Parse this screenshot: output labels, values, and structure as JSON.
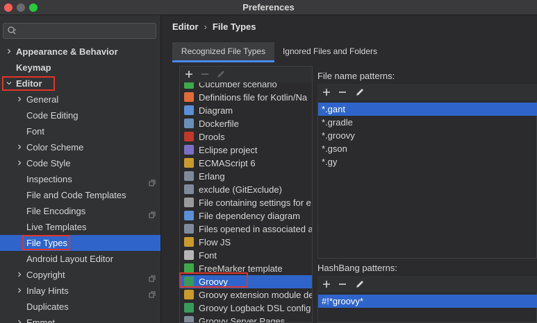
{
  "window": {
    "title": "Preferences"
  },
  "search": {
    "placeholder": ""
  },
  "sidebar": {
    "items": [
      {
        "label": "Appearance & Behavior",
        "bold": true,
        "chevron": "right"
      },
      {
        "label": "Keymap",
        "bold": true,
        "chevron": "none"
      },
      {
        "label": "Editor",
        "bold": true,
        "chevron": "down"
      },
      {
        "label": "General",
        "chevron": "right"
      },
      {
        "label": "Code Editing",
        "chevron": "none"
      },
      {
        "label": "Font",
        "chevron": "none"
      },
      {
        "label": "Color Scheme",
        "chevron": "right"
      },
      {
        "label": "Code Style",
        "chevron": "right"
      },
      {
        "label": "Inspections",
        "chevron": "none",
        "copy": true
      },
      {
        "label": "File and Code Templates",
        "chevron": "none"
      },
      {
        "label": "File Encodings",
        "chevron": "none",
        "copy": true
      },
      {
        "label": "Live Templates",
        "chevron": "none"
      },
      {
        "label": "File Types",
        "chevron": "none",
        "selected": true
      },
      {
        "label": "Android Layout Editor",
        "chevron": "none"
      },
      {
        "label": "Copyright",
        "chevron": "right",
        "copy": true
      },
      {
        "label": "Inlay Hints",
        "chevron": "right",
        "copy": true
      },
      {
        "label": "Duplicates",
        "chevron": "none"
      },
      {
        "label": "Emmet",
        "chevron": "right"
      }
    ]
  },
  "breadcrumb": {
    "parent": "Editor",
    "separator": "›",
    "current": "File Types"
  },
  "tabs": [
    {
      "label": "Recognized File Types",
      "active": true
    },
    {
      "label": "Ignored Files and Folders",
      "active": false
    }
  ],
  "file_types": {
    "toolbar": {
      "add": "+",
      "remove": "−",
      "edit": "edit-icon"
    },
    "items": [
      {
        "label": "Cucumber scenario",
        "icon_color": "#3fa84a"
      },
      {
        "label": "Definitions file for Kotlin/Na",
        "icon_color": "#e06c3a"
      },
      {
        "label": "Diagram",
        "icon_color": "#5b8fd6"
      },
      {
        "label": "Dockerfile",
        "icon_color": "#6a8fb8"
      },
      {
        "label": "Drools",
        "icon_color": "#c0392b"
      },
      {
        "label": "Eclipse project",
        "icon_color": "#7b6fc4"
      },
      {
        "label": "ECMAScript 6",
        "icon_color": "#c99a2e"
      },
      {
        "label": "Erlang",
        "icon_color": "#7f8b9a"
      },
      {
        "label": "exclude (GitExclude)",
        "icon_color": "#7f8b9a"
      },
      {
        "label": "File containing settings for e",
        "icon_color": "#9a9a9a"
      },
      {
        "label": "File dependency diagram",
        "icon_color": "#5b8fd6"
      },
      {
        "label": "Files opened in associated a",
        "icon_color": "#7f8b9a"
      },
      {
        "label": "Flow JS",
        "icon_color": "#c99a2e"
      },
      {
        "label": "Font",
        "icon_color": "#b5b5b5"
      },
      {
        "label": "FreeMarker template",
        "icon_color": "#3fa84a"
      },
      {
        "label": "Groovy",
        "icon_color": "#3a9a5a",
        "selected": true
      },
      {
        "label": "Groovy extension module de",
        "icon_color": "#c99a2e"
      },
      {
        "label": "Groovy Logback DSL config",
        "icon_color": "#3a9a5a"
      },
      {
        "label": "Groovy Server Pages",
        "icon_color": "#7f8b9a"
      }
    ]
  },
  "file_name_patterns": {
    "title": "File name patterns:",
    "toolbar": {
      "add": "+",
      "remove": "−",
      "edit": "edit-icon"
    },
    "items": [
      {
        "label": "*.gant",
        "selected": true
      },
      {
        "label": "*.gradle"
      },
      {
        "label": "*.groovy"
      },
      {
        "label": "*.gson"
      },
      {
        "label": "*.gy"
      }
    ]
  },
  "hashbang_patterns": {
    "title": "HashBang patterns:",
    "toolbar": {
      "add": "+",
      "remove": "−",
      "edit": "edit-icon"
    },
    "items": [
      {
        "label": "#!*groovy*",
        "selected": true
      }
    ]
  },
  "colors": {
    "accent": "#2f65ca",
    "highlight_box": "#e0342a",
    "tab_underline": "#4a88f7"
  }
}
